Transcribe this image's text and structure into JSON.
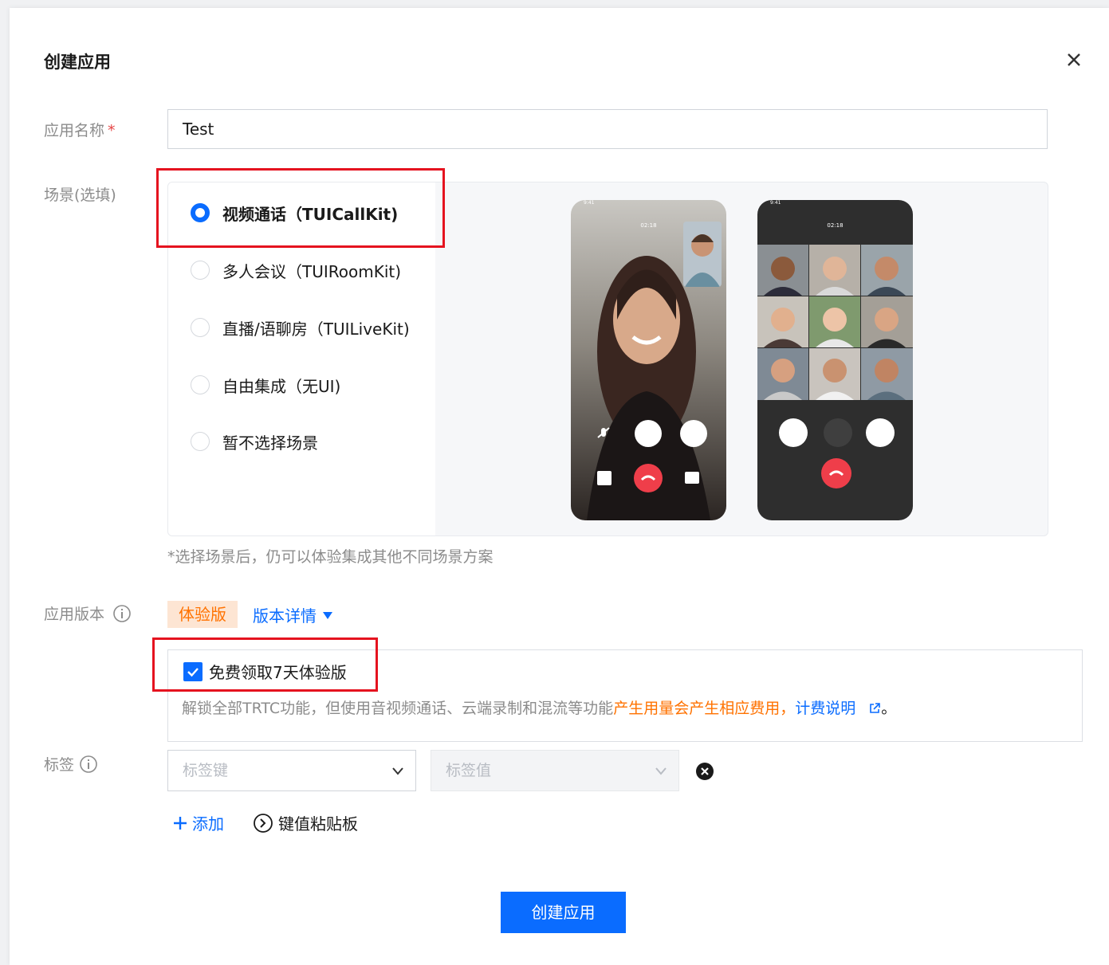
{
  "dialog": {
    "title": "创建应用",
    "close_icon": "close-icon"
  },
  "form": {
    "app_name_label": "应用名称",
    "app_name_required": "*",
    "app_name_value": "Test",
    "scene_label": "场景(选填)",
    "scene_options": [
      {
        "label": "视频通话（TUICallKit)",
        "selected": true
      },
      {
        "label": "多人会议（TUIRoomKit)",
        "selected": false
      },
      {
        "label": "直播/语聊房（TUILiveKit)",
        "selected": false
      },
      {
        "label": "自由集成（无UI)",
        "selected": false
      },
      {
        "label": "暂不选择场景",
        "selected": false
      }
    ],
    "scene_hint": "*选择场景后，仍可以体验集成其他不同场景方案",
    "version_label": "应用版本",
    "version_badge": "体验版",
    "version_detail_link": "版本详情",
    "trial_checkbox_label": "免费领取7天体验版",
    "trial_checked": true,
    "trial_desc_normal": "解锁全部TRTC功能，但使用音视频通话、云端录制和混流等功能",
    "trial_desc_warning": "产生用量会产生相应费用，",
    "trial_desc_link": "计费说明",
    "trial_desc_end": "。",
    "tag_label": "标签",
    "tag_key_placeholder": "标签键",
    "tag_value_placeholder": "标签值",
    "add_link": "添加",
    "clipboard_link": "键值粘贴板",
    "submit_button": "创建应用"
  },
  "preview": {
    "status_time": "9:41",
    "call_timer": "02:18"
  },
  "colors": {
    "primary": "#0a6cff",
    "warning": "#ff7200",
    "highlight": "#e5131f",
    "hangup": "#ef3e4a"
  }
}
